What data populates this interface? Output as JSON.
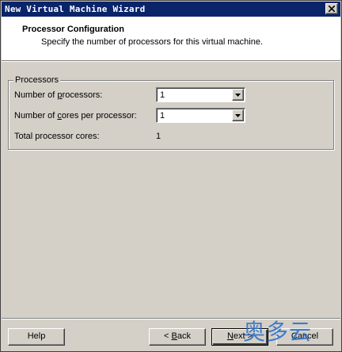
{
  "window": {
    "title": "New Virtual Machine Wizard"
  },
  "header": {
    "title": "Processor Configuration",
    "subtitle": "Specify the number of processors for this virtual machine."
  },
  "processors": {
    "legend": "Processors",
    "num_processors_pre": "Number of ",
    "num_processors_key": "p",
    "num_processors_post": "rocessors:",
    "num_processors_value": "1",
    "cores_pre": "Number of ",
    "cores_key": "c",
    "cores_post": "ores per processor:",
    "cores_value": "1",
    "total_label": "Total processor cores:",
    "total_value": "1"
  },
  "buttons": {
    "help": "Help",
    "back_pre": "< ",
    "back_key": "B",
    "back_post": "ack",
    "next_key": "N",
    "next_post": "ext >",
    "cancel": "Cancel"
  },
  "watermark": {
    "text": "奥多云"
  }
}
